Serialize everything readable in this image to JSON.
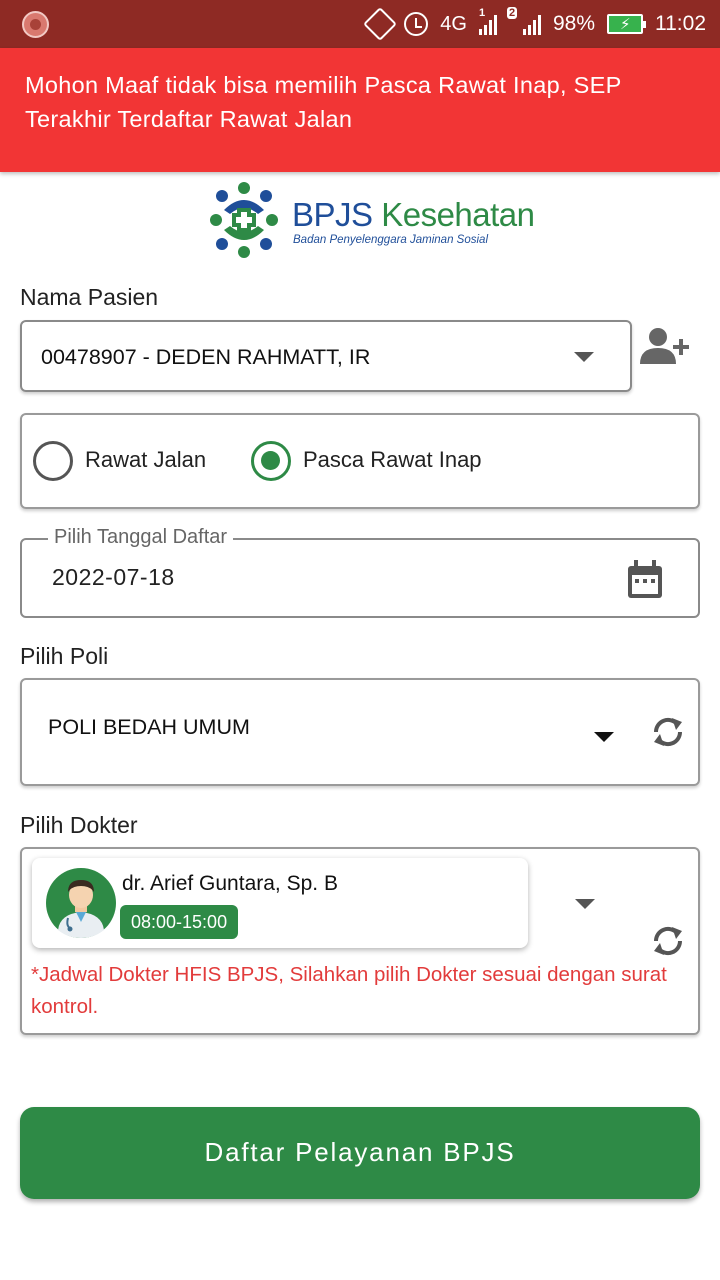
{
  "status_bar": {
    "network": "4G",
    "sim1_index": "1",
    "sim2_index": "2",
    "battery": "98%",
    "time": "11:02"
  },
  "alert": {
    "message": "Mohon Maaf tidak bisa memilih Pasca Rawat Inap, SEP Terakhir Terdaftar Rawat Jalan",
    "color": "#f23535"
  },
  "logo": {
    "title_1": "BPJS",
    "title_2": "Kesehatan",
    "subtitle": "Badan Penyelenggara Jaminan Sosial"
  },
  "patient": {
    "label": "Nama Pasien",
    "value": "00478907 - DEDEN RAHMATT, IR",
    "add_icon": "add-user-icon"
  },
  "care_type": {
    "options": [
      {
        "label": "Rawat Jalan",
        "selected": false
      },
      {
        "label": "Pasca Rawat Inap",
        "selected": true
      }
    ]
  },
  "date": {
    "label": "Pilih Tanggal Daftar",
    "value": "2022-07-18",
    "icon": "calendar-icon"
  },
  "poli": {
    "label": "Pilih Poli",
    "value": "POLI BEDAH UMUM",
    "refresh_icon": "refresh-icon"
  },
  "doctor": {
    "label": "Pilih Dokter",
    "name": "dr. Arief Guntara, Sp. B",
    "schedule": "08:00-15:00",
    "note": "*Jadwal Dokter HFIS BPJS, Silahkan pilih Dokter sesuai dengan surat kontrol."
  },
  "submit": {
    "label": "Daftar Pelayanan BPJS",
    "color": "#2e8a46"
  }
}
